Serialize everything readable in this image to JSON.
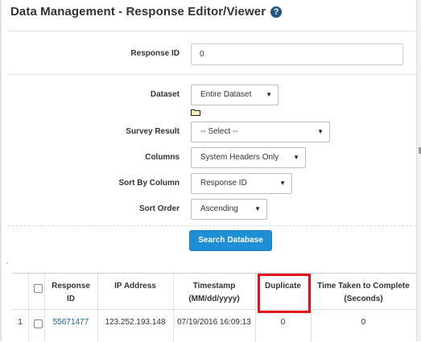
{
  "header": {
    "title": "Data Management - Response Editor/Viewer",
    "help_icon": "question-circle-icon"
  },
  "form": {
    "response_id": {
      "label": "Response ID",
      "value": "0"
    },
    "dataset": {
      "label": "Dataset",
      "value": "Entire Dataset",
      "folder_icon": "folder-icon"
    },
    "survey_result": {
      "label": "Survey Result",
      "value": "-- Select --"
    },
    "columns": {
      "label": "Columns",
      "value": "System Headers Only"
    },
    "sort_by_column": {
      "label": "Sort By Column",
      "value": "Response ID"
    },
    "sort_order": {
      "label": "Sort Order",
      "value": "Ascending"
    },
    "search_button": "Search Database"
  },
  "table": {
    "headers": {
      "response_id": [
        "Response",
        "ID"
      ],
      "ip_address": "IP Address",
      "timestamp": [
        "Timestamp",
        "(MM/dd/yyyy)"
      ],
      "duplicate": "Duplicate",
      "time_taken": [
        "Time Taken to Complete",
        "(Seconds)"
      ]
    },
    "rows": [
      {
        "index": "1",
        "response_id": "55671477",
        "ip_address": "123.252.193.148",
        "timestamp": "07/19/2016 16:09:13",
        "duplicate": "0",
        "time_taken": "0"
      }
    ]
  },
  "colors": {
    "accent": "#1f8fd5",
    "highlight": "#e0111c",
    "link": "#1a5fa8"
  }
}
